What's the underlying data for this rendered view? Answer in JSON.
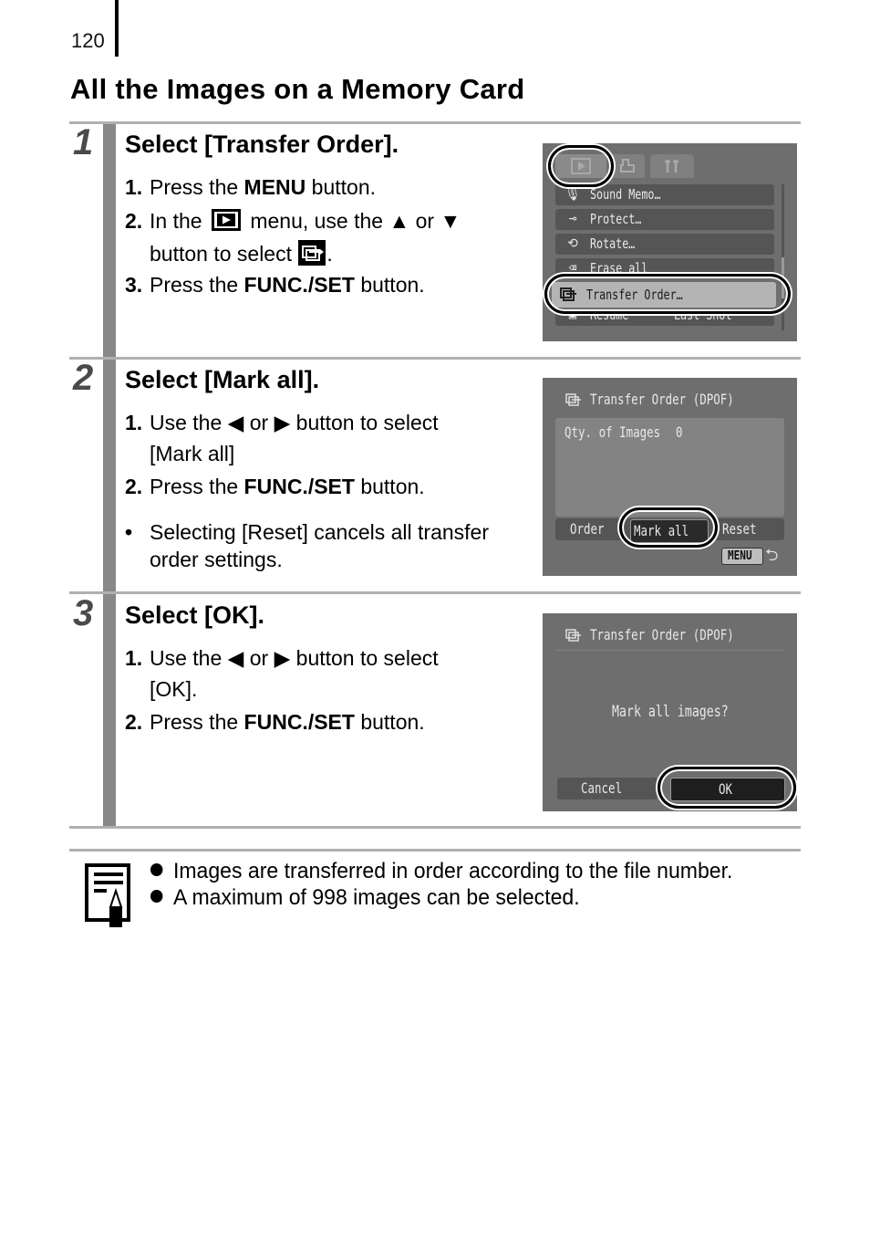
{
  "page": {
    "number": "120",
    "title": "All the Images on a Memory Card"
  },
  "steps": [
    {
      "number": "1",
      "heading": "Select [Transfer Order].",
      "lines": {
        "l1_num": "1.",
        "l1_a": "Press the ",
        "l1_b": "MENU",
        "l1_c": " button.",
        "l2_num": "2.",
        "l2_a": "In the ",
        "l2_b": " menu, use the ▲ or ▼",
        "l2_cont_a": "button to select ",
        "l2_cont_b": ".",
        "l3_num": "3.",
        "l3_a": "Press the ",
        "l3_b": "FUNC./SET",
        "l3_c": " button."
      },
      "screen": {
        "tabs": [
          "play-tab",
          "print-tab",
          "setup-tab"
        ],
        "menu_items": [
          {
            "icon": "sound-memo-icon",
            "label": "Sound Memo…"
          },
          {
            "icon": "protect-key-icon",
            "label": "Protect…"
          },
          {
            "icon": "rotate-icon",
            "label": "Rotate…"
          },
          {
            "icon": "erase-all-icon",
            "label": "Erase all"
          },
          {
            "icon": "transfer-order-icon",
            "label": "Transfer Order…",
            "selected": true
          },
          {
            "icon": "resume-icon",
            "label": "Resume",
            "value": "Last Shot"
          }
        ]
      }
    },
    {
      "number": "2",
      "heading": "Select [Mark all].",
      "lines": {
        "l1_num": "1.",
        "l1_a": "Use the ◀ or ▶ button to select",
        "l1_cont": "[Mark all]",
        "l2_num": "2.",
        "l2_a": "Press the ",
        "l2_b": "FUNC./SET",
        "l2_c": " button.",
        "bullet": "•",
        "b1": "Selecting [Reset] cancels all transfer",
        "b1_cont": "order settings."
      },
      "screen": {
        "title": "Transfer Order (DPOF)",
        "qty_label": "Qty. of Images",
        "qty_value": "0",
        "buttons": [
          "Order",
          "Mark all",
          "Reset"
        ],
        "selected": "Mark all",
        "menu_key": "MENU",
        "back_symbol": "⮌"
      }
    },
    {
      "number": "3",
      "heading": "Select [OK].",
      "lines": {
        "l1_num": "1.",
        "l1_a": "Use the ◀ or ▶ button to select",
        "l1_cont": "[OK].",
        "l2_num": "2.",
        "l2_a": "Press the ",
        "l2_b": "FUNC./SET",
        "l2_c": " button."
      },
      "screen": {
        "title": "Transfer Order (DPOF)",
        "prompt": "Mark all images?",
        "buttons": [
          "Cancel",
          "OK"
        ],
        "selected": "OK"
      }
    }
  ],
  "notes": [
    "Images are transferred in order according to the file number.",
    "A maximum of 998 images can be selected."
  ],
  "colors": {
    "step_bar": "#888888",
    "rule": "#b0b0b0",
    "screen_bg": "#6e6e6e",
    "menu_row": "#555555",
    "menu_row_selected": "#b4b4b4"
  }
}
